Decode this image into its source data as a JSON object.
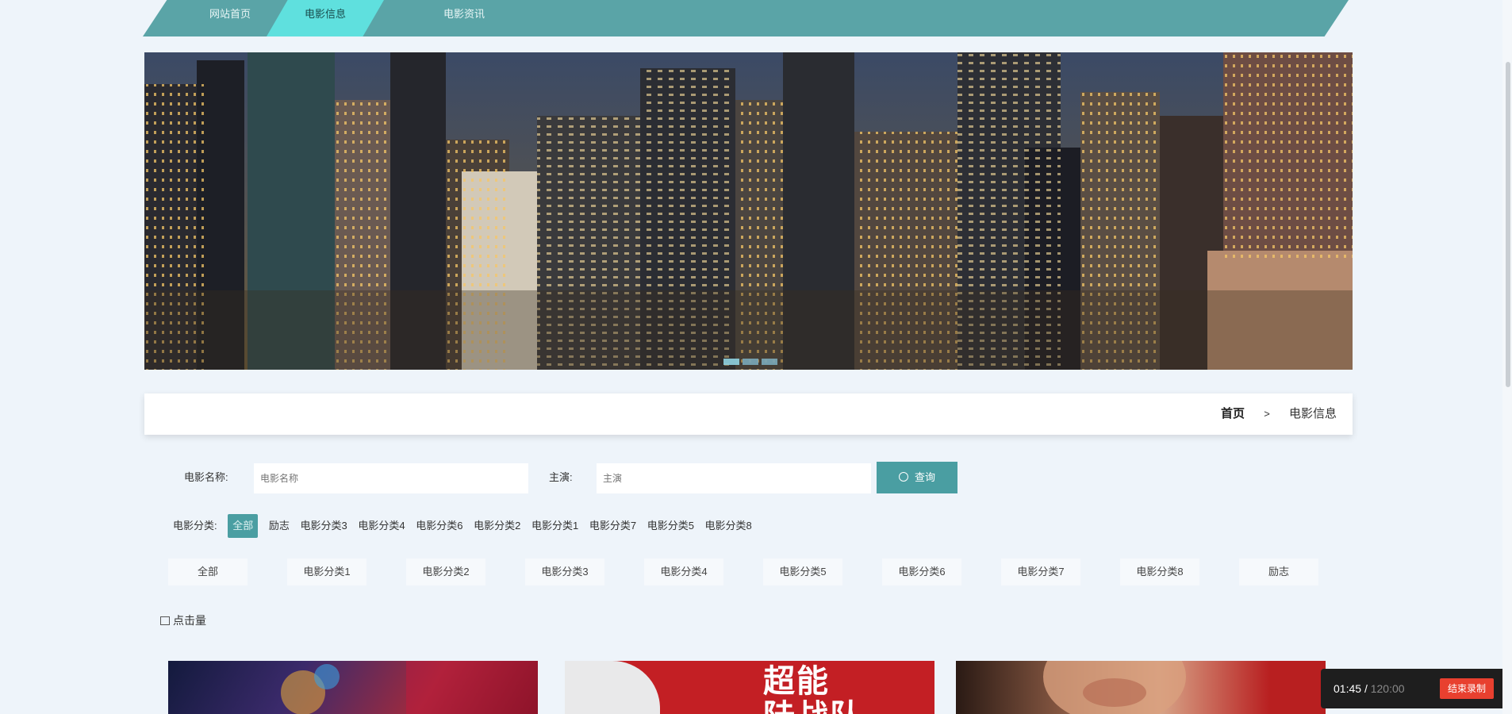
{
  "nav": {
    "tabs": [
      {
        "label": "网站首页",
        "active": false
      },
      {
        "label": "电影信息",
        "active": true
      },
      {
        "label": "电影资讯",
        "active": false
      }
    ]
  },
  "breadcrumb": {
    "home": "首页",
    "separator": ">",
    "current": "电影信息"
  },
  "search": {
    "name_label": "电影名称:",
    "name_placeholder": "电影名称",
    "actor_label": "主演:",
    "actor_placeholder": "主演",
    "button_label": "查询"
  },
  "category_filter": {
    "label": "电影分类:",
    "chips": [
      "全部",
      "励志",
      "电影分类3",
      "电影分类4",
      "电影分类6",
      "电影分类2",
      "电影分类1",
      "电影分类7",
      "电影分类5",
      "电影分类8"
    ],
    "active_index": 0
  },
  "category_tabs": [
    "全部",
    "电影分类1",
    "电影分类2",
    "电影分类3",
    "电影分类4",
    "电影分类5",
    "电影分类6",
    "电影分类7",
    "电影分类8",
    "励志"
  ],
  "sort": {
    "label": "点击量"
  },
  "cards": [
    {
      "poster_text": ""
    },
    {
      "poster_text": "超能\n陆战队"
    },
    {
      "poster_text": ""
    }
  ],
  "timer": {
    "elapsed": "01:45",
    "separator": "/",
    "total": "120:00",
    "stop_label": "结束录制"
  },
  "colors": {
    "nav_bg": "#5aa4a7",
    "nav_active": "#5fe0de",
    "accent": "#4a9ea2",
    "page_bg": "#eef4fa",
    "stop_button": "#e8402f"
  }
}
